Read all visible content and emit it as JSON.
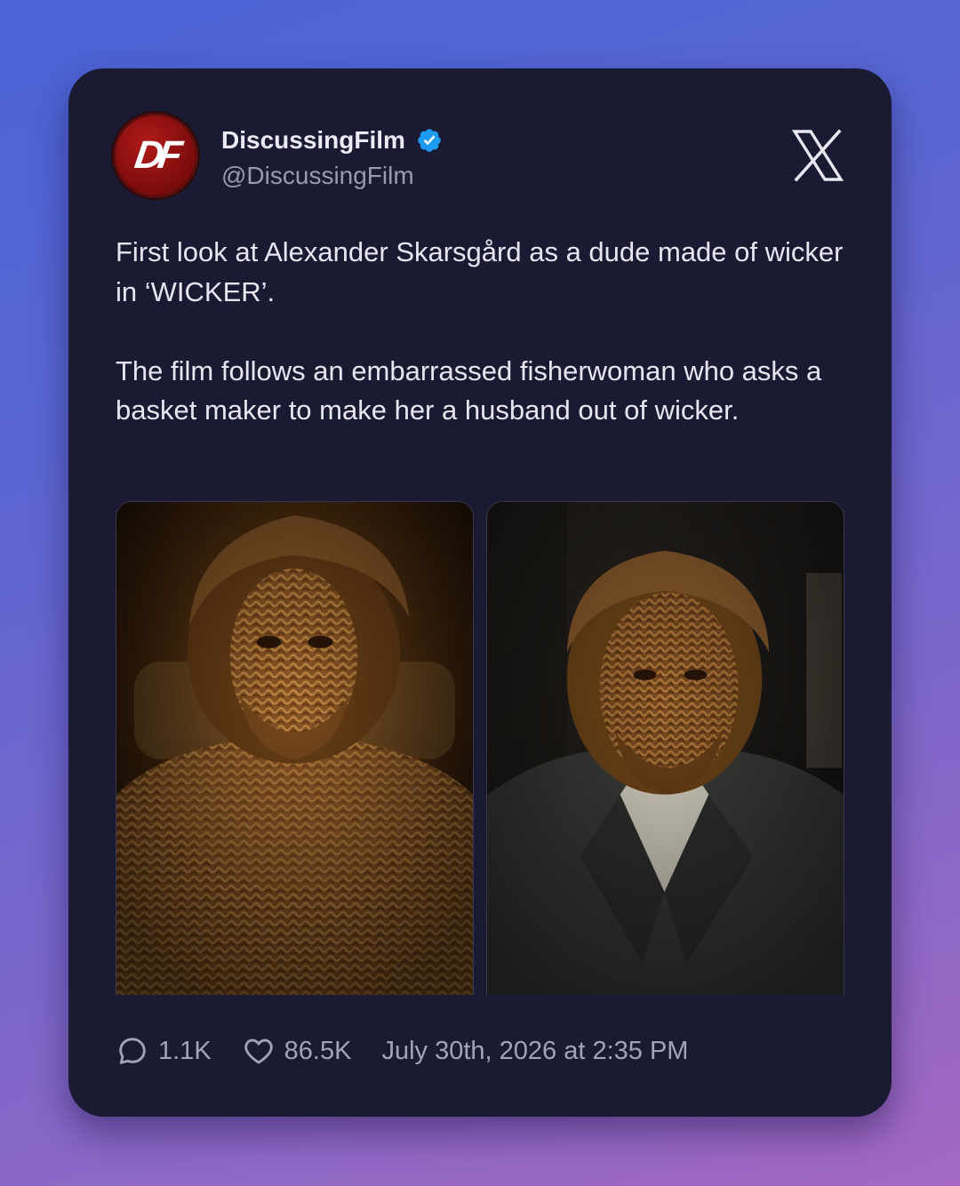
{
  "author": {
    "display_name": "DiscussingFilm",
    "handle": "@DiscussingFilm",
    "verified": true,
    "avatar_text": "DF",
    "avatar_icon": "discussingfilm-logo-icon"
  },
  "platform_icon": "x-logo-icon",
  "tweet": {
    "paragraphs": [
      "First look at Alexander Skarsgård as a dude made of wicker in ‘WICKER’.",
      "The film follows an embarrassed fisherwoman who asks a basket maker to make her a husband out of wicker."
    ]
  },
  "media": [
    {
      "name": "wicker-man-reclining-photo",
      "description_icon": "photo"
    },
    {
      "name": "wicker-man-suit-photo",
      "description_icon": "photo"
    }
  ],
  "stats": {
    "replies": "1.1K",
    "likes": "86.5K",
    "timestamp": "July 30th, 2026 at 2:35 PM"
  },
  "colors": {
    "background_start": "#4a63d6",
    "background_end": "#a468c2",
    "card": "#1b1a33",
    "verified": "#1d9bf0",
    "text_primary": "#e6e5f0",
    "text_secondary": "#9a99ad"
  }
}
